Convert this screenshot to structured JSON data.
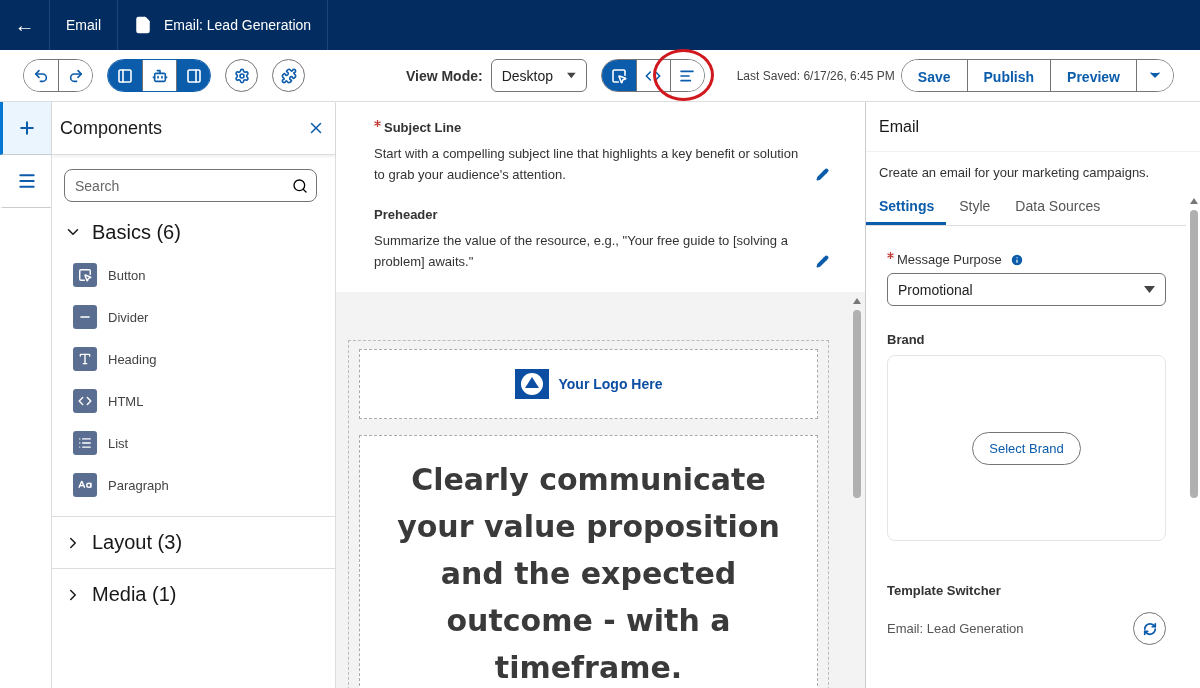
{
  "header": {
    "back": "←",
    "tabs": [
      {
        "kind": "app",
        "label": "Email"
      },
      {
        "kind": "document",
        "label": "Email: Lead Generation"
      }
    ]
  },
  "toolbar": {
    "history": [
      {
        "kind": "undo"
      },
      {
        "kind": "redo"
      }
    ],
    "panels": [
      {
        "kind": "left",
        "selected": true
      },
      {
        "kind": "ai",
        "selected": false
      },
      {
        "kind": "right",
        "selected": true
      }
    ],
    "tools": [
      {
        "kind": "settings"
      },
      {
        "kind": "extension"
      }
    ],
    "view_mode_label": "View Mode:",
    "view_mode": "Desktop",
    "modes": [
      {
        "kind": "select",
        "selected": true
      },
      {
        "kind": "code",
        "selected": false
      },
      {
        "kind": "text",
        "selected": false,
        "highlighted": true
      }
    ],
    "last_saved": "Last Saved: 6/17/26, 6:45 PM",
    "actions": [
      "Save",
      "Publish",
      "Preview"
    ]
  },
  "rail": [
    {
      "kind": "add",
      "selected": true
    },
    {
      "kind": "outline",
      "selected": false
    }
  ],
  "components": {
    "title": "Components",
    "search": {
      "placeholder": "Search"
    },
    "sections": [
      {
        "label": "Basics (6)",
        "expanded": true,
        "items": [
          {
            "kind": "button",
            "label": "Button"
          },
          {
            "kind": "divider",
            "label": "Divider"
          },
          {
            "kind": "heading",
            "label": "Heading"
          },
          {
            "kind": "html",
            "label": "HTML"
          },
          {
            "kind": "list",
            "label": "List"
          },
          {
            "kind": "paragraph",
            "label": "Paragraph"
          }
        ]
      },
      {
        "label": "Layout (3)",
        "expanded": false
      },
      {
        "label": "Media (1)",
        "expanded": false
      }
    ]
  },
  "canvas": {
    "fields": [
      {
        "label": "Subject Line",
        "required": true,
        "text": "Start with a compelling subject line that highlights a key benefit or solution to grab your audience's attention."
      },
      {
        "label": "Preheader",
        "required": false,
        "text": "Summarize the value of the resource, e.g., \"Your free guide to [solving a problem] awaits.\""
      }
    ],
    "logo": "Your Logo Here",
    "headline": "Clearly communicate your value proposition and the expected outcome - with a timeframe."
  },
  "properties": {
    "title": "Email",
    "description": "Create an email for your marketing campaigns.",
    "tabs": [
      {
        "label": "Settings",
        "selected": true
      },
      {
        "label": "Style",
        "selected": false
      },
      {
        "label": "Data Sources",
        "selected": false
      }
    ],
    "message_purpose": {
      "label": "Message Purpose",
      "required": true,
      "value": "Promotional"
    },
    "brand": {
      "label": "Brand",
      "button": "Select Brand"
    },
    "template_switcher": {
      "label": "Template Switcher",
      "value": "Email: Lead Generation"
    }
  }
}
